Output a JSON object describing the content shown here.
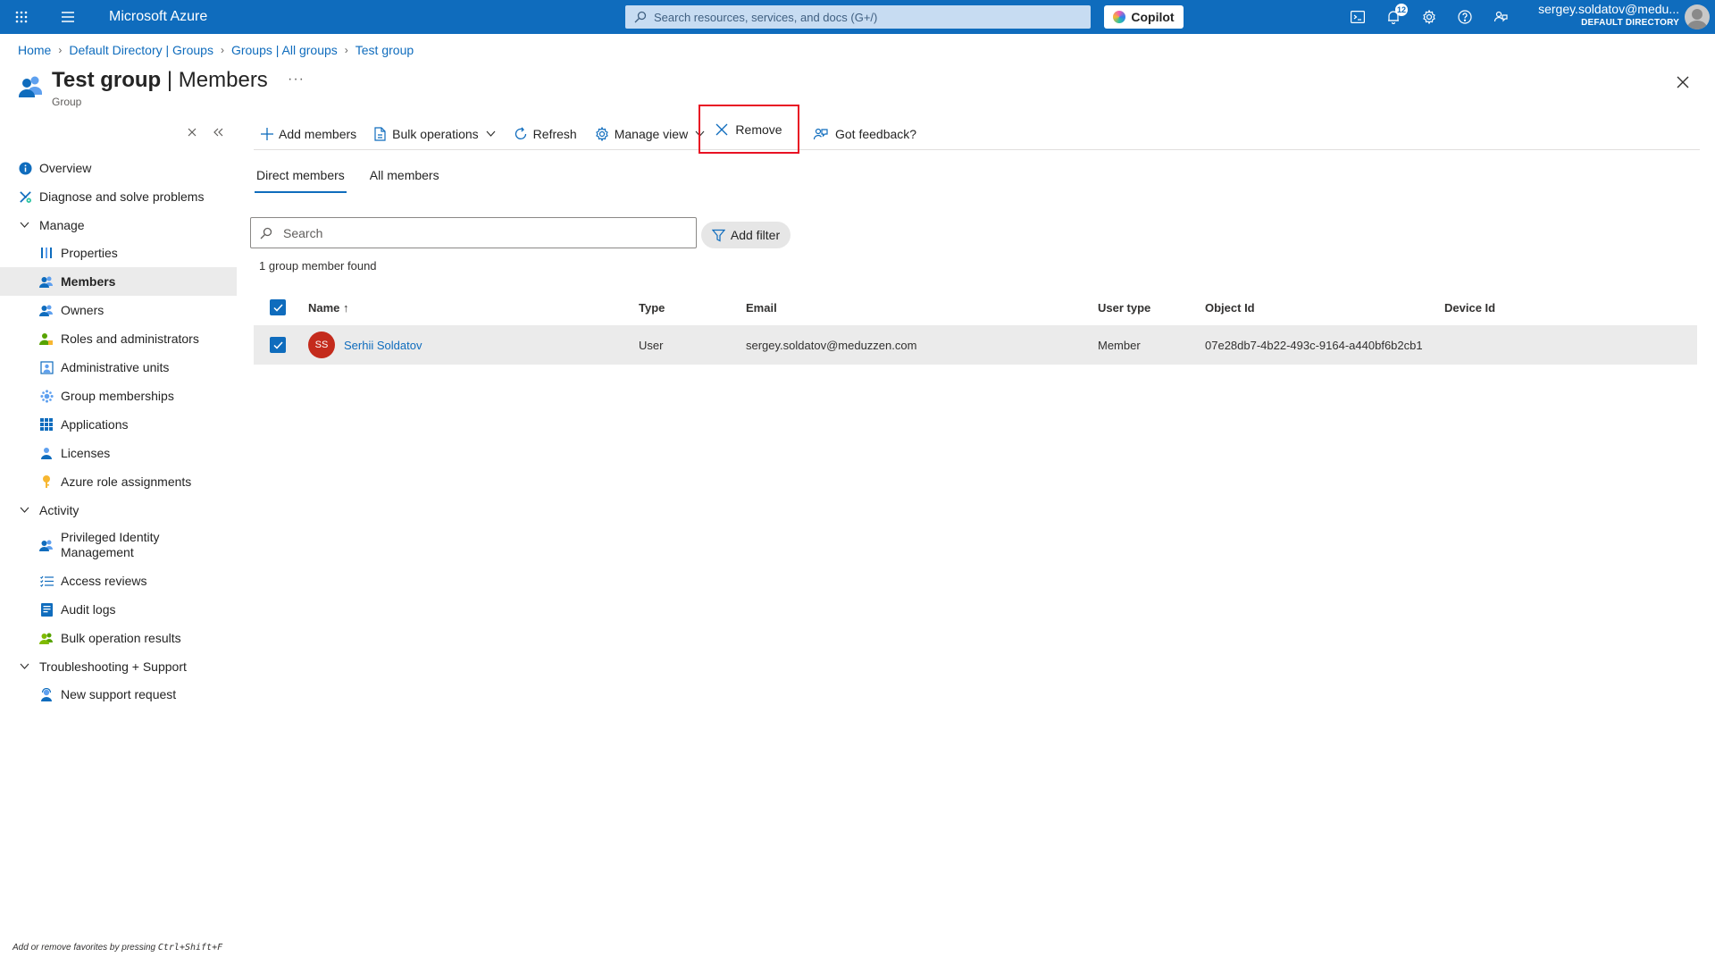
{
  "topbar": {
    "brand": "Microsoft Azure",
    "search_placeholder": "Search resources, services, and docs (G+/)",
    "copilot_label": "Copilot",
    "notification_count": "12",
    "account_name": "sergey.soldatov@medu...",
    "account_directory": "DEFAULT DIRECTORY"
  },
  "breadcrumb": [
    "Home",
    "Default Directory | Groups",
    "Groups | All groups",
    "Test group"
  ],
  "header": {
    "title_bold": "Test group",
    "title_rest": " | Members",
    "more": "···",
    "subtitle": "Group"
  },
  "nav": {
    "overview": "Overview",
    "diagnose": "Diagnose and solve problems",
    "manage": "Manage",
    "properties": "Properties",
    "members": "Members",
    "owners": "Owners",
    "roles": "Roles and administrators",
    "admin_units": "Administrative units",
    "group_memberships": "Group memberships",
    "applications": "Applications",
    "licenses": "Licenses",
    "azure_roles": "Azure role assignments",
    "activity": "Activity",
    "pim": "Privileged Identity Management",
    "access_reviews": "Access reviews",
    "audit_logs": "Audit logs",
    "bulk_results": "Bulk operation results",
    "troubleshooting": "Troubleshooting + Support",
    "new_support": "New support request"
  },
  "footer": {
    "prefix": "Add or remove favorites by pressing ",
    "shortcut": "Ctrl+Shift+F"
  },
  "toolbar": {
    "add_members": "Add members",
    "bulk_operations": "Bulk operations",
    "refresh": "Refresh",
    "manage_view": "Manage view",
    "remove": "Remove",
    "feedback": "Got feedback?"
  },
  "tabs": {
    "direct": "Direct members",
    "all": "All members"
  },
  "search": {
    "placeholder": "Search",
    "add_filter": "Add filter"
  },
  "result_count": "1 group member found",
  "table": {
    "headers": {
      "name": "Name ↑",
      "type": "Type",
      "email": "Email",
      "user_type": "User type",
      "object_id": "Object Id",
      "device_id": "Device Id"
    },
    "rows": [
      {
        "initials": "SS",
        "name": "Serhii Soldatov",
        "type": "User",
        "email": "sergey.soldatov@meduzzen.com",
        "user_type": "Member",
        "object_id": "07e28db7-4b22-493c-9164-a440bf6b2cb1",
        "device_id": ""
      }
    ]
  },
  "colors": {
    "brand_blue": "#0f6cbd",
    "highlight_red": "#e81123",
    "avatar_red": "#c42b1c"
  }
}
